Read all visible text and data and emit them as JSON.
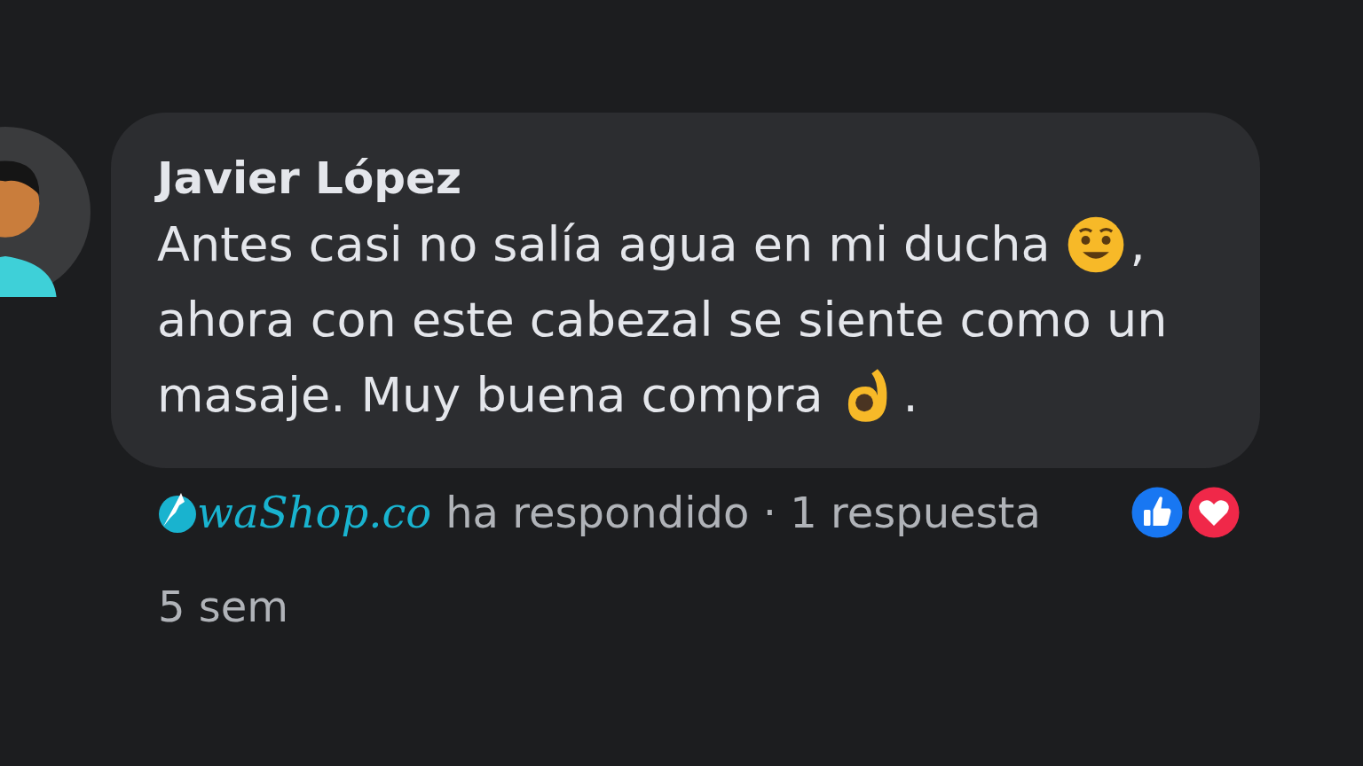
{
  "comment": {
    "author": "Javier López",
    "lines": [
      [
        {
          "kind": "text",
          "text": "Antes casi no salía agua en mi ducha"
        },
        {
          "kind": "smile"
        },
        {
          "kind": "text",
          "text": ","
        }
      ],
      [
        {
          "kind": "text",
          "text": "ahora con este cabezal se siente como un"
        }
      ],
      [
        {
          "kind": "text",
          "text": "masaje. Muy buena compra"
        },
        {
          "kind": "ok_hand"
        },
        {
          "kind": "text",
          "text": "."
        }
      ]
    ]
  },
  "reply_summary": {
    "responder": "waShop.co",
    "text": "ha respondido · 1 respuesta"
  },
  "reactions": [
    {
      "kind": "like"
    },
    {
      "kind": "love"
    }
  ],
  "timestamp": "5 sem"
}
